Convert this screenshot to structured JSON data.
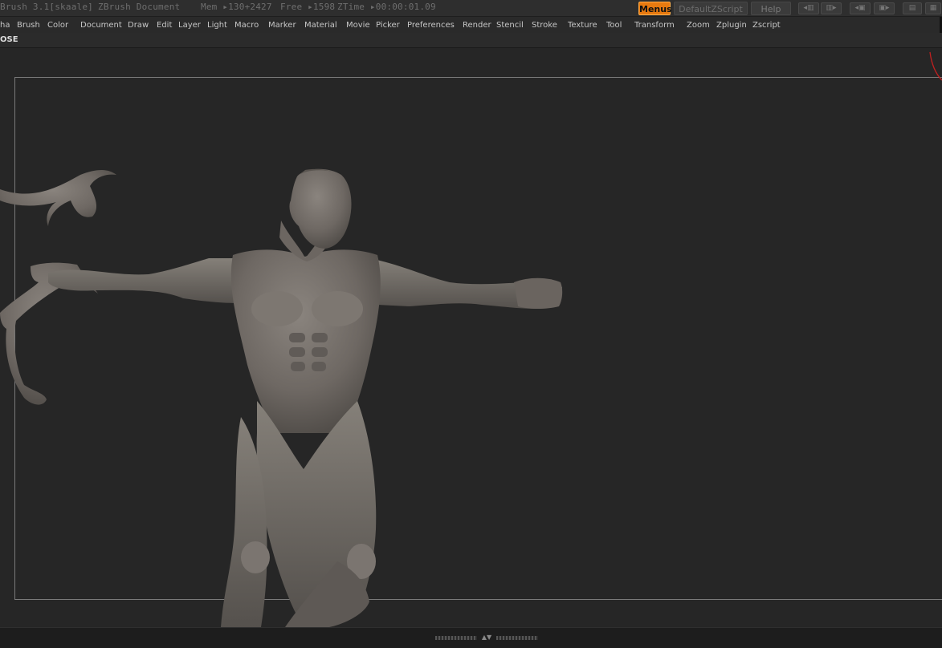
{
  "titlebar": {
    "app_title": "Brush  3.1[skaale]",
    "doc_title": "ZBrush Document",
    "mem": "Mem ▸130+2427",
    "free": "Free ▸1598",
    "ztime": "ZTime ▸00:00:01.09",
    "menus_label": "Menus",
    "default_script_label": "DefaultZScript",
    "help_label": "Help"
  },
  "menubar": {
    "items": [
      "ha",
      "Brush",
      "Color",
      "Document",
      "Draw",
      "Edit",
      "Layer",
      "Light",
      "Macro",
      "Marker",
      "Material",
      "Movie",
      "Picker",
      "Preferences",
      "Render",
      "Stencil",
      "Stroke",
      "Texture",
      "Tool",
      "Transform",
      "Zoom",
      "Zplugin",
      "Zscript"
    ]
  },
  "subbar": {
    "close_label": "OSE"
  },
  "colors": {
    "accent": "#e87a10",
    "background": "#262626",
    "model": "#6f6964"
  },
  "icons": [
    "scroll-left-icon",
    "scroll-right-icon",
    "layout-icon",
    "undo-layout-icon",
    "lock-icon",
    "grip-arrows-icon"
  ]
}
